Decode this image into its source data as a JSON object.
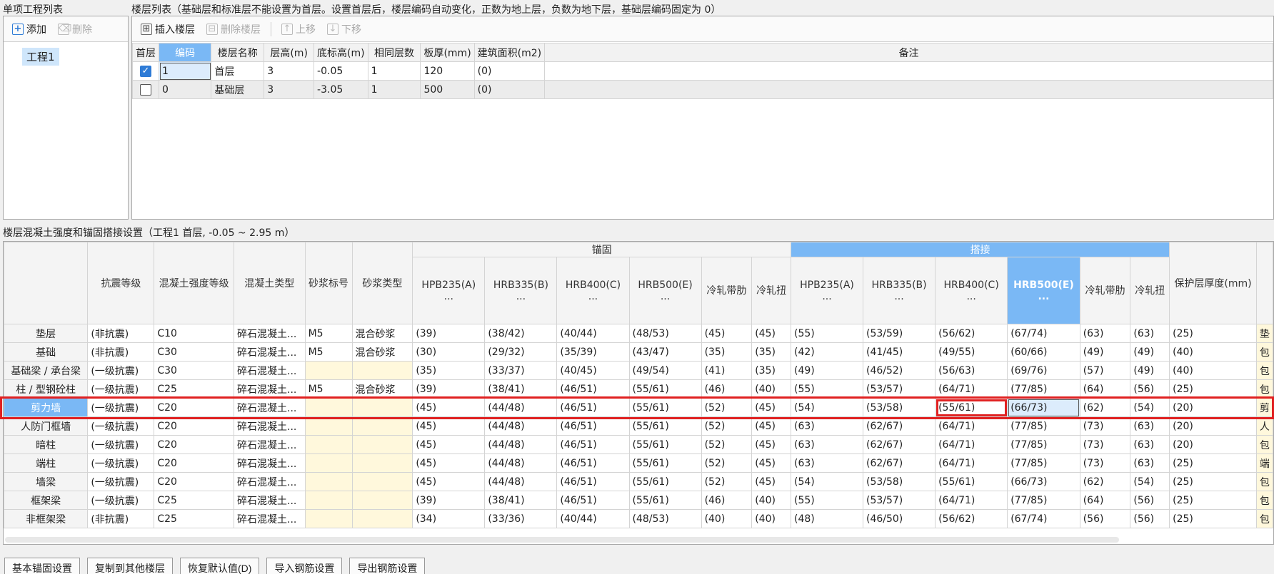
{
  "project_list": {
    "title": "单项工程列表",
    "add_label": "添加",
    "delete_label": "删除",
    "items": [
      "工程1"
    ]
  },
  "floor_list": {
    "title": "楼层列表（基础层和标准层不能设置为首层。设置首层后，楼层编码自动变化，正数为地上层，负数为地下层，基础层编码固定为 0）",
    "toolbar": {
      "insert_label": "插入楼层",
      "delete_label": "删除楼层",
      "up_label": "上移",
      "down_label": "下移"
    },
    "headers": [
      "首层",
      "编码",
      "楼层名称",
      "层高(m)",
      "底标高(m)",
      "相同层数",
      "板厚(mm)",
      "建筑面积(m2)",
      "备注"
    ],
    "rows": [
      {
        "first": true,
        "code": "1",
        "name": "首层",
        "height": "3",
        "bottom": "-0.05",
        "same": "1",
        "thickness": "120",
        "area": "(0)",
        "note": ""
      },
      {
        "first": false,
        "code": "0",
        "name": "基础层",
        "height": "3",
        "bottom": "-3.05",
        "same": "1",
        "thickness": "500",
        "area": "(0)",
        "note": ""
      }
    ]
  },
  "settings": {
    "title": "楼层混凝土强度和锚固搭接设置（工程1  首层, -0.05 ~ 2.95 m）",
    "group_anchor": "锚固",
    "group_lap": "搭接",
    "headers": {
      "seismic": "抗震等级",
      "concrete_grade": "混凝土强度等级",
      "concrete_type": "混凝土类型",
      "mortar_grade": "砂浆标号",
      "mortar_type": "砂浆类型",
      "hpb235": "HPB235(A)",
      "hrb335": "HRB335(B)",
      "hrb400": "HRB400(C)",
      "hrb500": "HRB500(E)",
      "ellipsis": "...",
      "cold_rib": "冷轧带肋",
      "cold_twist": "冷轧扭",
      "cover": "保护层厚度(mm)"
    },
    "rows": [
      {
        "name": "垫层",
        "seismic": "(非抗震)",
        "cg": "C10",
        "ct": "碎石混凝土...",
        "mg": "M5",
        "mt": "混合砂浆",
        "a": [
          "(39)",
          "(38/42)",
          "(40/44)",
          "(48/53)",
          "(45)",
          "(45)"
        ],
        "l": [
          "(55)",
          "(53/59)",
          "(56/62)",
          "(67/74)",
          "(63)",
          "(63)"
        ],
        "cover": "(25)",
        "extra": "垫"
      },
      {
        "name": "基础",
        "seismic": "(非抗震)",
        "cg": "C30",
        "ct": "碎石混凝土...",
        "mg": "M5",
        "mt": "混合砂浆",
        "a": [
          "(30)",
          "(29/32)",
          "(35/39)",
          "(43/47)",
          "(35)",
          "(35)"
        ],
        "l": [
          "(42)",
          "(41/45)",
          "(49/55)",
          "(60/66)",
          "(49)",
          "(49)"
        ],
        "cover": "(40)",
        "extra": "包"
      },
      {
        "name": "基础梁 / 承台梁",
        "seismic": "(一级抗震)",
        "cg": "C30",
        "ct": "碎石混凝土...",
        "mg": "",
        "mt": "",
        "a": [
          "(35)",
          "(33/37)",
          "(40/45)",
          "(49/54)",
          "(41)",
          "(35)"
        ],
        "l": [
          "(49)",
          "(46/52)",
          "(56/63)",
          "(69/76)",
          "(57)",
          "(49)"
        ],
        "cover": "(40)",
        "extra": "包"
      },
      {
        "name": "柱 / 型钢砼柱",
        "seismic": "(一级抗震)",
        "cg": "C25",
        "ct": "碎石混凝土...",
        "mg": "M5",
        "mt": "混合砂浆",
        "a": [
          "(39)",
          "(38/41)",
          "(46/51)",
          "(55/61)",
          "(46)",
          "(40)"
        ],
        "l": [
          "(55)",
          "(53/57)",
          "(64/71)",
          "(77/85)",
          "(64)",
          "(56)"
        ],
        "cover": "(25)",
        "extra": "包"
      },
      {
        "name": "剪力墙",
        "seismic": "(一级抗震)",
        "cg": "C20",
        "ct": "碎石混凝土...",
        "mg": "",
        "mt": "",
        "a": [
          "(45)",
          "(44/48)",
          "(46/51)",
          "(55/61)",
          "(52)",
          "(45)"
        ],
        "l": [
          "(54)",
          "(53/58)",
          "(55/61)",
          "(66/73)",
          "(62)",
          "(54)"
        ],
        "cover": "(20)",
        "extra": "剪"
      },
      {
        "name": "人防门框墙",
        "seismic": "(一级抗震)",
        "cg": "C20",
        "ct": "碎石混凝土...",
        "mg": "",
        "mt": "",
        "a": [
          "(45)",
          "(44/48)",
          "(46/51)",
          "(55/61)",
          "(52)",
          "(45)"
        ],
        "l": [
          "(63)",
          "(62/67)",
          "(64/71)",
          "(77/85)",
          "(73)",
          "(63)"
        ],
        "cover": "(20)",
        "extra": "人"
      },
      {
        "name": "暗柱",
        "seismic": "(一级抗震)",
        "cg": "C20",
        "ct": "碎石混凝土...",
        "mg": "",
        "mt": "",
        "a": [
          "(45)",
          "(44/48)",
          "(46/51)",
          "(55/61)",
          "(52)",
          "(45)"
        ],
        "l": [
          "(63)",
          "(62/67)",
          "(64/71)",
          "(77/85)",
          "(73)",
          "(63)"
        ],
        "cover": "(20)",
        "extra": "包"
      },
      {
        "name": "端柱",
        "seismic": "(一级抗震)",
        "cg": "C20",
        "ct": "碎石混凝土...",
        "mg": "",
        "mt": "",
        "a": [
          "(45)",
          "(44/48)",
          "(46/51)",
          "(55/61)",
          "(52)",
          "(45)"
        ],
        "l": [
          "(63)",
          "(62/67)",
          "(64/71)",
          "(77/85)",
          "(73)",
          "(63)"
        ],
        "cover": "(25)",
        "extra": "端"
      },
      {
        "name": "墙梁",
        "seismic": "(一级抗震)",
        "cg": "C20",
        "ct": "碎石混凝土...",
        "mg": "",
        "mt": "",
        "a": [
          "(45)",
          "(44/48)",
          "(46/51)",
          "(55/61)",
          "(52)",
          "(45)"
        ],
        "l": [
          "(54)",
          "(53/58)",
          "(55/61)",
          "(66/73)",
          "(62)",
          "(54)"
        ],
        "cover": "(25)",
        "extra": "包"
      },
      {
        "name": "框架梁",
        "seismic": "(一级抗震)",
        "cg": "C25",
        "ct": "碎石混凝土...",
        "mg": "",
        "mt": "",
        "a": [
          "(39)",
          "(38/41)",
          "(46/51)",
          "(55/61)",
          "(46)",
          "(40)"
        ],
        "l": [
          "(55)",
          "(53/57)",
          "(64/71)",
          "(77/85)",
          "(64)",
          "(56)"
        ],
        "cover": "(25)",
        "extra": "包"
      },
      {
        "name": "非框架梁",
        "seismic": "(非抗震)",
        "cg": "C25",
        "ct": "碎石混凝土...",
        "mg": "",
        "mt": "",
        "a": [
          "(34)",
          "(33/36)",
          "(40/44)",
          "(48/53)",
          "(40)",
          "(40)"
        ],
        "l": [
          "(48)",
          "(46/50)",
          "(56/62)",
          "(67/74)",
          "(56)",
          "(56)"
        ],
        "cover": "(25)",
        "extra": "包"
      }
    ]
  },
  "bottom_buttons": [
    "基本锚固设置",
    "复制到其他楼层",
    "恢复默认值(D)",
    "导入钢筋设置",
    "导出钢筋设置"
  ],
  "colors": {
    "accent": "#7ab8f5",
    "highlight": "#e02020",
    "yellow_cell": "#fff8dc"
  }
}
